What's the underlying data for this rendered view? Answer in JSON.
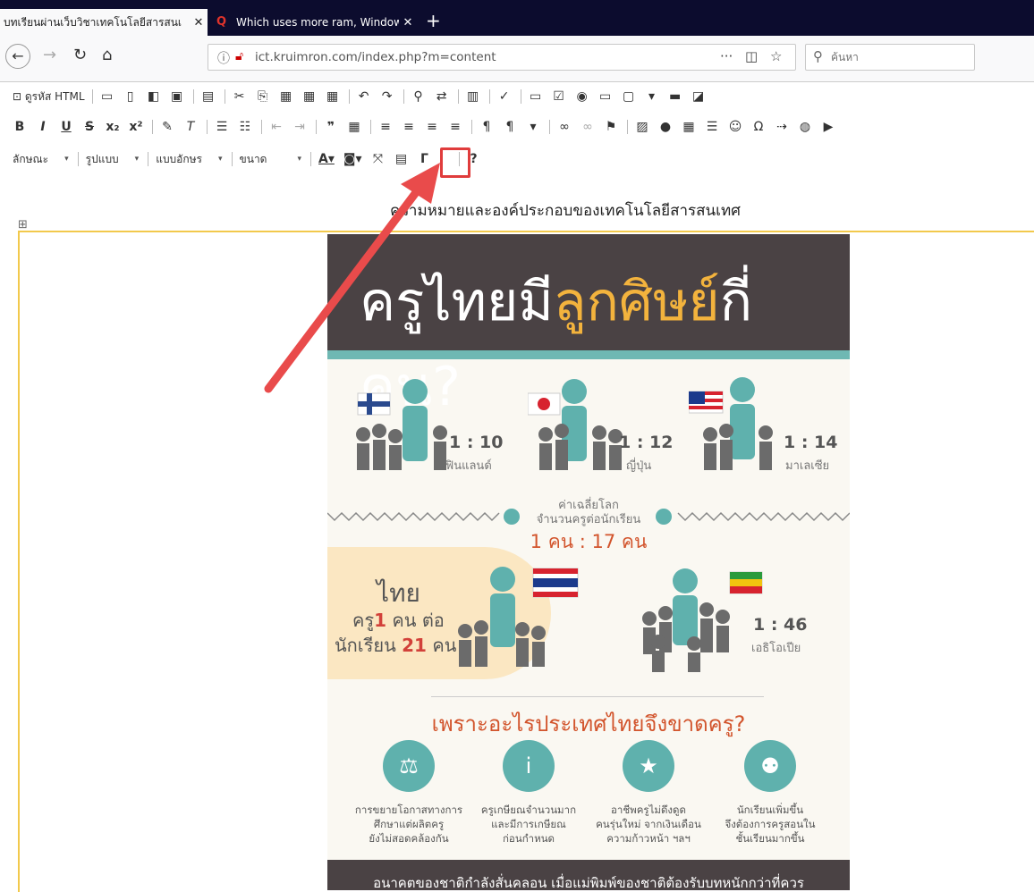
{
  "browser": {
    "tabs": [
      {
        "title": "บทเรียนผ่านเว็บวิชาเทคโนโลยีสารสนเ",
        "active": true
      },
      {
        "title": "Which uses more ram, Window",
        "active": false
      }
    ],
    "url": "ict.kruimron.com/index.php?m=content",
    "search_placeholder": "ค้นหา",
    "tab_close": "✕",
    "new_tab": "+"
  },
  "editor": {
    "toolbar_row1": {
      "source_label": "ดูรหัส HTML"
    },
    "toolbar_row3": {
      "style_label": "ลักษณะ",
      "format_label": "รูปแบบ",
      "font_label": "แบบอักษร",
      "size_label": "ขนาด",
      "help": "?"
    },
    "highlighted_button": "maximize-button"
  },
  "content": {
    "title": "ความหมายและองค์ประกอบของเทคโนโลยีสารสนเทศ",
    "infographic": {
      "headline_part1": "ครูไทยมี",
      "headline_part2": "ลูกศิษย์",
      "headline_part3": "กี่คน?",
      "countries": [
        {
          "ratio": "1 : 10",
          "name": "ฟินแลนด์"
        },
        {
          "ratio": "1 : 12",
          "name": "ญี่ปุ่น"
        },
        {
          "ratio": "1 : 14",
          "name": "มาเลเซีย"
        }
      ],
      "world_avg_label": "ค่าเฉลี่ยโลก",
      "world_avg_sub": "จำนวนครูต่อนักเรียน",
      "world_avg_value": "1 คน : 17 คน",
      "thai_title": "ไทย",
      "thai_line2_pre": "ครู",
      "thai_line2_num": "1",
      "thai_line2_post": "คน ต่อ",
      "thai_line3_pre": "นักเรียน",
      "thai_line3_num": "21",
      "thai_line3_post": "คน",
      "ethiopia": {
        "ratio": "1 : 46",
        "name": "เอธิโอเปีย"
      },
      "why_title": "เพราะอะไรประเทศไทยจึงขาดครู?",
      "reasons": [
        {
          "line1": "การขยายโอกาสทางการ",
          "line2": "ศึกษาแต่ผลิตครู",
          "line3": "ยังไม่สอดคล้องกัน"
        },
        {
          "line1": "ครูเกษียณจำนวนมาก",
          "line2": "และมีการเกษียณ",
          "line3": "ก่อนกำหนด"
        },
        {
          "line1": "อาชีพครูไม่ดึงดูด",
          "line2": "คนรุ่นใหม่ จากเงินเดือน",
          "line3": "ความก้าวหน้า ฯลฯ"
        },
        {
          "line1": "นักเรียนเพิ่มขึ้น",
          "line2": "จึงต้องการครูสอนใน",
          "line3": "ชั้นเรียนมากขึ้น"
        }
      ],
      "footer": "อนาคตของชาติกำลังสั่นคลอน เมื่อแม่พิมพ์ของชาติต้องรับบทหนักกว่าที่ควร"
    }
  },
  "colors": {
    "accent_red": "#e03c3c",
    "teal": "#5fb1ad",
    "orange": "#d2542c",
    "dark": "#4a4244"
  }
}
